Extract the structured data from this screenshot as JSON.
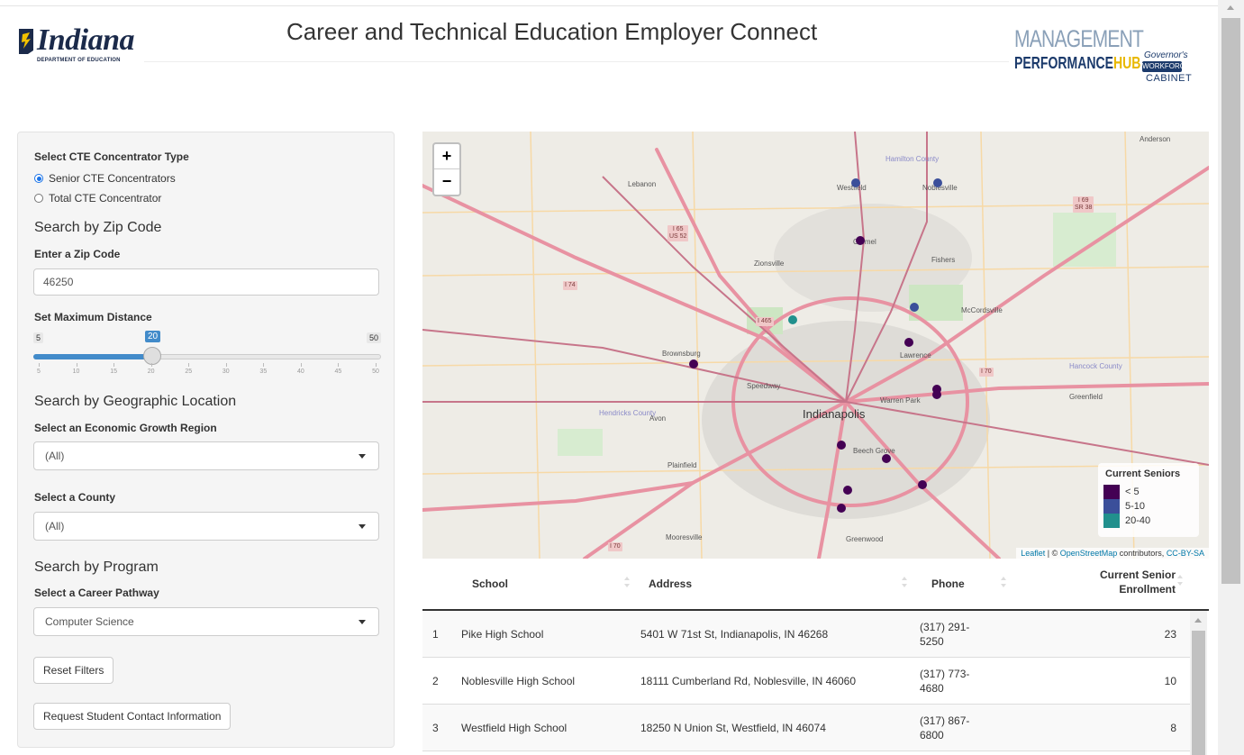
{
  "header": {
    "title": "Career and Technical Education Employer Connect",
    "logo_left_name": "Indiana",
    "logo_left_sub": "DEPARTMENT OF EDUCATION",
    "logo_right_line1": "MANAGEMENT",
    "logo_right_line2a": "PERFORMANCE",
    "logo_right_line2b": "HUB",
    "logo_cabinet_1": "Governor's",
    "logo_cabinet_2": "WORKFORCE",
    "logo_cabinet_3": "CABINET"
  },
  "sidebar": {
    "concentrator_label": "Select CTE Concentrator Type",
    "concentrator_options": [
      "Senior CTE Concentrators",
      "Total CTE Concentrator"
    ],
    "concentrator_selected": 0,
    "zip_section": "Search by Zip Code",
    "zip_label": "Enter a Zip Code",
    "zip_value": "46250",
    "distance_label": "Set Maximum Distance",
    "distance": {
      "min": "5",
      "max": "50",
      "value": "20",
      "value_num": 20,
      "ticks": [
        "5",
        "10",
        "15",
        "20",
        "25",
        "30",
        "35",
        "40",
        "45",
        "50"
      ]
    },
    "geo_section": "Search by Geographic Location",
    "region_label": "Select an Economic Growth Region",
    "region_value": "(All)",
    "county_label": "Select a County",
    "county_value": "(All)",
    "program_section": "Search by Program",
    "pathway_label": "Select a Career Pathway",
    "pathway_value": "Computer Science",
    "reset_button": "Reset Filters",
    "request_button": "Request Student Contact Information"
  },
  "map": {
    "zoom_in": "+",
    "zoom_out": "−",
    "legend_title": "Current Seniors",
    "legend": [
      {
        "label": "< 5",
        "color": "#440154"
      },
      {
        "label": "5-10",
        "color": "#3b4f9a"
      },
      {
        "label": "20-40",
        "color": "#21908d"
      }
    ],
    "attribution_leaflet": "Leaflet",
    "attribution_mid": " | © ",
    "attribution_osm": "OpenStreetMap",
    "attribution_tail": " contributors, ",
    "attribution_cc": "CC-BY-SA",
    "places": {
      "anderson": "Anderson",
      "westfield": "Westfield",
      "noblesville": "Noblesville",
      "lebanon": "Lebanon",
      "carmel": "Carmel",
      "fishers": "Fishers",
      "zionsville": "Zionsville",
      "mccordsville": "McCordsville",
      "brownsburg": "Brownsburg",
      "lawrence": "Lawrence",
      "speedway": "Speedway",
      "warren_park": "Warren Park",
      "greenfield": "Greenfield",
      "hendricks": "Hendricks County",
      "avon": "Avon",
      "indianapolis": "Indianapolis",
      "beech_grove": "Beech Grove",
      "plainfield": "Plainfield",
      "mooresville": "Mooresville",
      "greenwood": "Greenwood",
      "hancock": "Hancock County",
      "hamilton": "Hamilton County"
    },
    "shields": {
      "i65": "I 65",
      "us52": "US 52",
      "i74": "I 74",
      "i465": "I 465",
      "i69": "I 69",
      "sr38": "SR 38",
      "i70_east": "I 70",
      "i70_west": "I 70"
    }
  },
  "table": {
    "headers": [
      "School",
      "Address",
      "Phone",
      "Current Senior",
      "Enrollment"
    ],
    "rows": [
      {
        "n": "1",
        "school": "Pike High School",
        "address": "5401 W 71st St, Indianapolis, IN 46268",
        "phone1": "(317) 291-",
        "phone2": "5250",
        "enroll": "23"
      },
      {
        "n": "2",
        "school": "Noblesville High School",
        "address": "18111 Cumberland Rd, Noblesville, IN 46060",
        "phone1": "(317) 773-",
        "phone2": "4680",
        "enroll": "10"
      },
      {
        "n": "3",
        "school": "Westfield High School",
        "address": "18250 N Union St, Westfield, IN 46074",
        "phone1": "(317) 867-",
        "phone2": "6800",
        "enroll": "8"
      }
    ]
  }
}
